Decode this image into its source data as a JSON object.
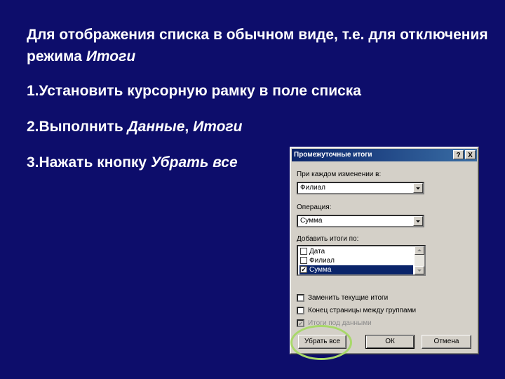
{
  "slide": {
    "intro_text": "Для отображения списка в обычном виде, т.е. для отключения режима ",
    "intro_italic": "Итоги",
    "step1": "1.Установить курсорную рамку в поле списка",
    "step2_prefix": "2.Выполнить ",
    "step2_italic1": "Данные",
    "step2_sep": ", ",
    "step2_italic2": "Итоги",
    "step3_prefix": "3.Нажать кнопку ",
    "step3_italic": "Убрать все"
  },
  "dialog": {
    "title": "Промежуточные итоги",
    "help_btn": "?",
    "close_btn": "X",
    "group_label": "При каждом изменении в:",
    "group_value": "Филиал",
    "operation_label": "Операция:",
    "operation_value": "Сумма",
    "add_totals_label": "Добавить итоги по:",
    "list_items": [
      {
        "label": "Дата",
        "checked": false
      },
      {
        "label": "Филиал",
        "checked": false
      },
      {
        "label": "Сумма",
        "checked": true
      }
    ],
    "options": [
      {
        "label": "Заменить текущие итоги",
        "checked": false,
        "enabled": true
      },
      {
        "label": "Конец страницы между группами",
        "checked": false,
        "enabled": true
      },
      {
        "label": "Итоги под данными",
        "checked": true,
        "enabled": false
      }
    ],
    "remove_all_btn": "Убрать все",
    "ok_btn": "ОК",
    "cancel_btn": "Отмена"
  },
  "colors": {
    "slide_background": "#0d0d6b",
    "dialog_face": "#d4d0c8",
    "titlebar": "#0a246a",
    "highlight_ring": "#a8d86a"
  },
  "glyphs": {
    "check": "✔"
  }
}
